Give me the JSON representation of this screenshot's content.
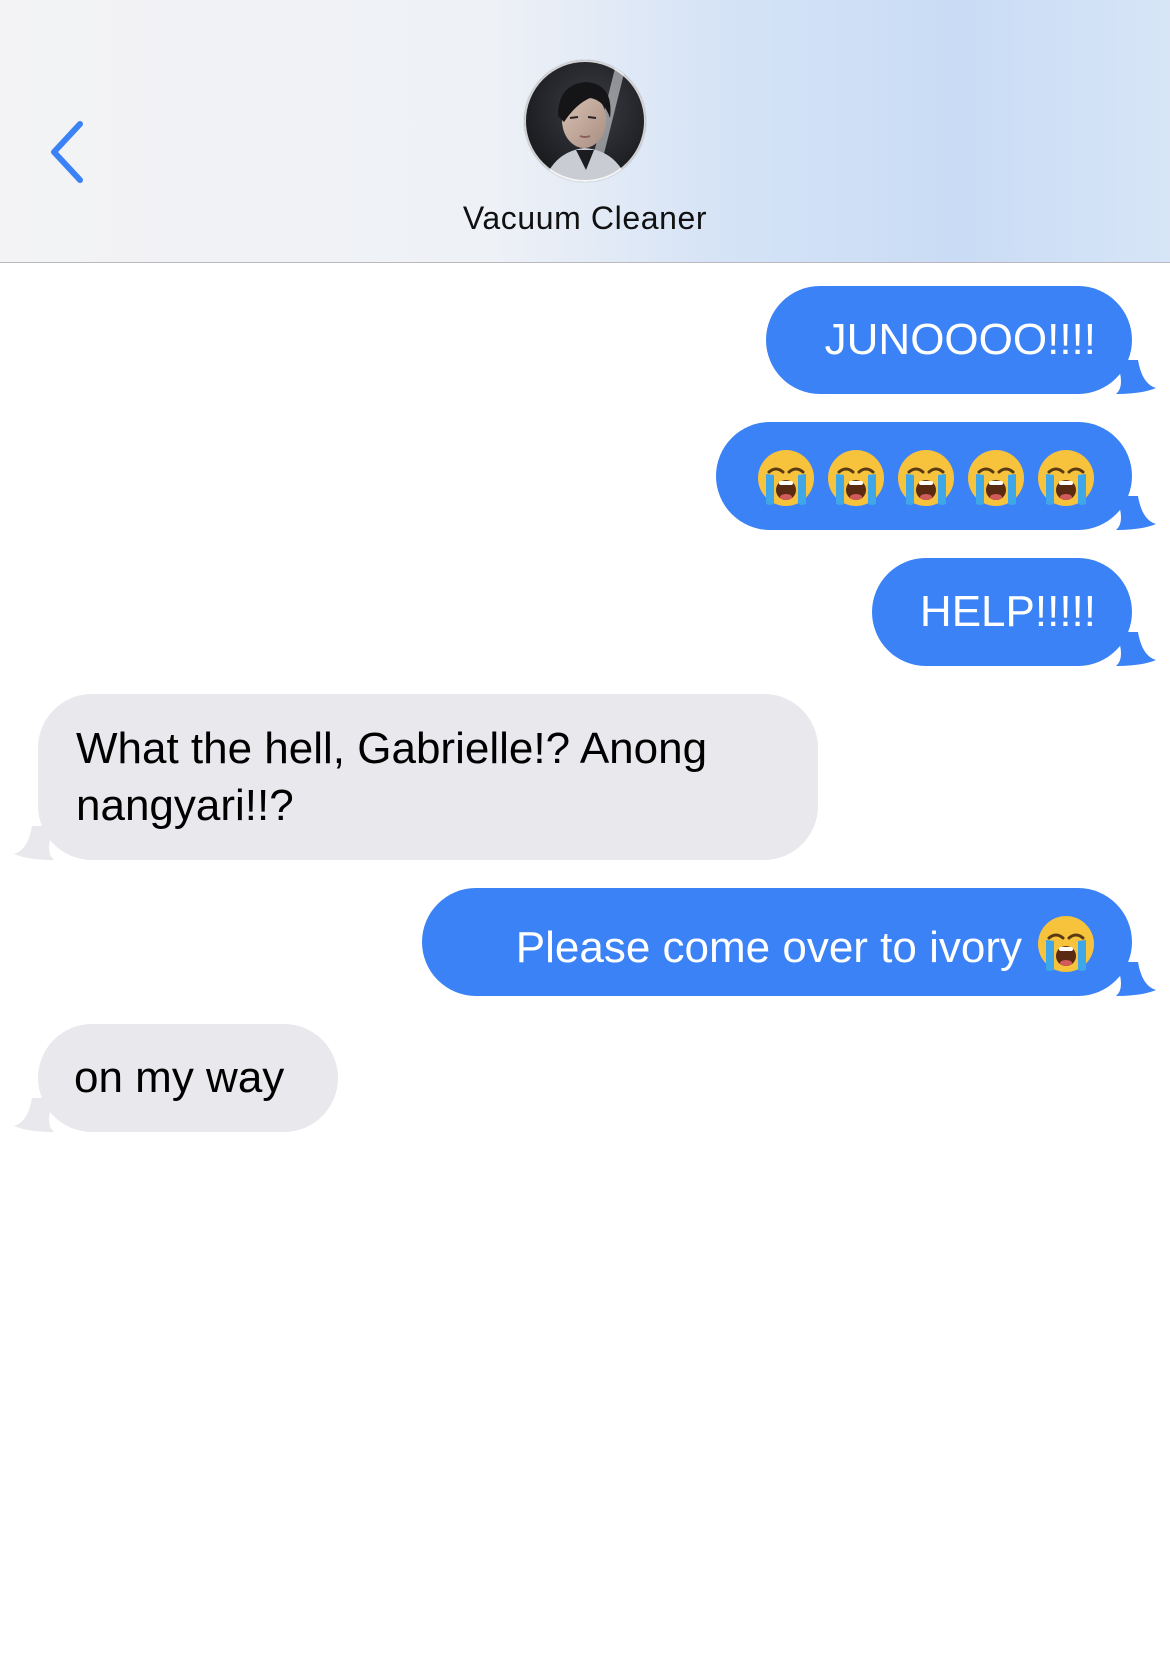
{
  "header": {
    "contact_name": "Vacuum Cleaner",
    "back_icon": "chevron-left-icon",
    "avatar": "contact-avatar-photo"
  },
  "colors": {
    "sent_bubble": "#3b82f6",
    "received_bubble": "#e8e8ed",
    "accent": "#3b82f6"
  },
  "messages": [
    {
      "direction": "sent",
      "text": "JUNOOOO!!!!"
    },
    {
      "direction": "sent",
      "text": "",
      "emoji": [
        "loudly-crying-face-icon",
        "loudly-crying-face-icon",
        "loudly-crying-face-icon",
        "loudly-crying-face-icon",
        "loudly-crying-face-icon"
      ]
    },
    {
      "direction": "sent",
      "text": "HELP!!!!!"
    },
    {
      "direction": "received",
      "text": "What the hell, Gabrielle!? Anong nangyari!!?"
    },
    {
      "direction": "sent",
      "text": "Please come over to ivory",
      "emoji": [
        "loudly-crying-face-icon"
      ]
    },
    {
      "direction": "received",
      "text": "on my way"
    }
  ]
}
